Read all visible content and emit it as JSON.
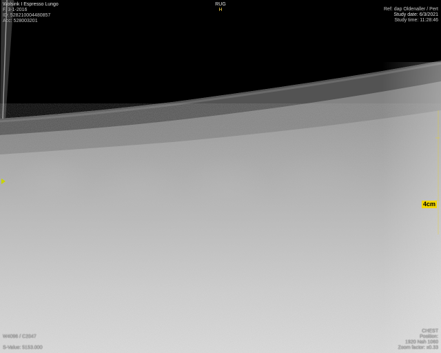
{
  "patient": {
    "name": "Wolsink I Espresso Lungo",
    "birth_line": "F. 3-1-2016",
    "id_line": "ID: 528210004480857",
    "acc_line": "Acc: 528003201"
  },
  "orientation": {
    "top_label": "RUG",
    "top_marker": "H"
  },
  "study": {
    "referrer_line": "Ref: dap Oldenaller / Pert",
    "date_line": "Study date: 6/3/2021",
    "time_line": "Study time: 11:28:46"
  },
  "window": {
    "wl_line": "W4096 / C2047",
    "value_line": "S-Value: 5153.000"
  },
  "series": {
    "body_part": "CHEST",
    "position_label": "Position:",
    "detail_line": "1920 Nah 1060",
    "zoom_line": "Zoom factor: x0.33"
  },
  "scale_marker": {
    "label": "4cm"
  },
  "colors": {
    "overlay_text": "#e6e6e6",
    "marker_yellow": "#f0d400",
    "background": "#000000"
  }
}
